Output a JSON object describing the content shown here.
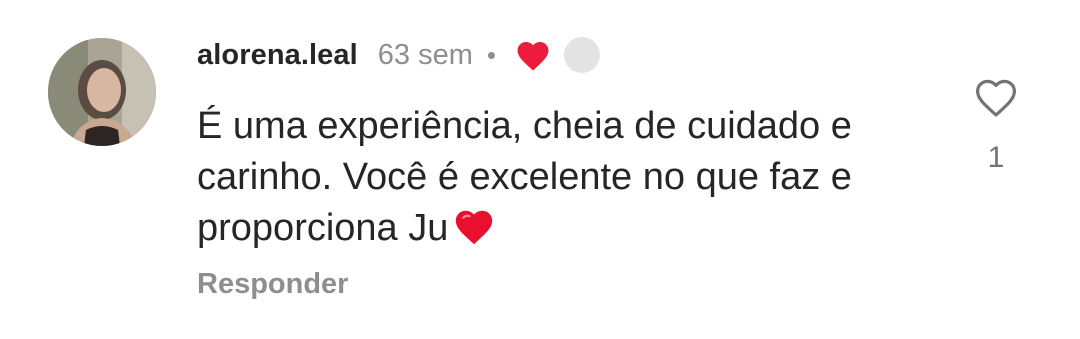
{
  "comment": {
    "username": "alorena.leal",
    "time_ago": "63 sem",
    "separator": "•",
    "text_lines": [
      "É uma experiência, cheia de cuidado e",
      "carinho. Você é excelente no que faz e",
      "proporciona Ju"
    ],
    "text_emoji_icon": "red-heart-emoji",
    "reply_label": "Responder",
    "like_count": "1",
    "liked_by_author_icon": "red-heart-icon",
    "like_icon": "heart-outline-icon"
  },
  "colors": {
    "text": "#262626",
    "muted": "#8e8e8e",
    "heart_red": "#ed1c3c",
    "reaction_gray": "#e3e3e3"
  }
}
